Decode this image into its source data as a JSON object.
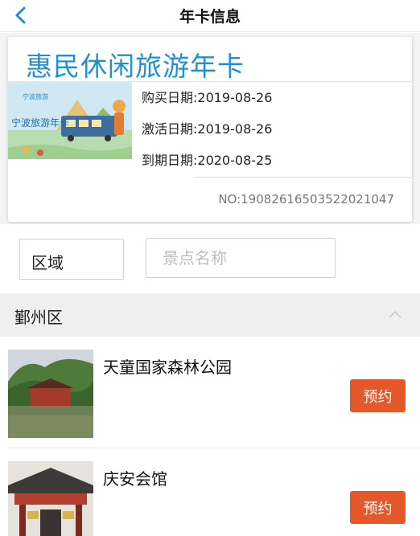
{
  "nav": {
    "title": "年卡信息",
    "back_icon": "chevron-left-icon",
    "accent": "#1e8fdb"
  },
  "card": {
    "title": "惠民休闲旅游年卡",
    "image_text": {
      "brand": "宁波旅游",
      "name": "宁波旅游年卡"
    },
    "purchase_date": "购买日期:2019-08-26",
    "activation_date": "激活日期:2019-08-26",
    "expiry_date": "到期日期:2020-08-25",
    "number": "NO:19082616503522021047"
  },
  "filters": {
    "region_label": "区域",
    "search_placeholder": "景点名称",
    "search_value": ""
  },
  "district": {
    "name": "鄞州区",
    "expanded": true,
    "toggle_icon": "chevron-up-icon"
  },
  "attractions": [
    {
      "name": "天童国家森林公园",
      "button_label": "预约"
    },
    {
      "name": "庆安会馆",
      "button_label": "预约"
    }
  ],
  "colors": {
    "title_blue": "#1e8fdb",
    "button_orange": "#e4582a",
    "header_gray": "#efefef"
  }
}
